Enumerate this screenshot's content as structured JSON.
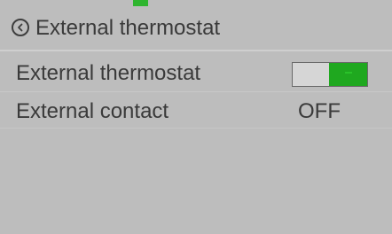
{
  "header": {
    "title": "External thermostat"
  },
  "settings": [
    {
      "label": "External thermostat",
      "control": "toggle",
      "state": "on"
    },
    {
      "label": "External contact",
      "value": "OFF"
    }
  ],
  "colors": {
    "background": "#bdbdbd",
    "toggle_on": "#1fa81f",
    "text": "#3a3a3a"
  },
  "icons": {
    "back": "chevron-left-circle-icon"
  }
}
